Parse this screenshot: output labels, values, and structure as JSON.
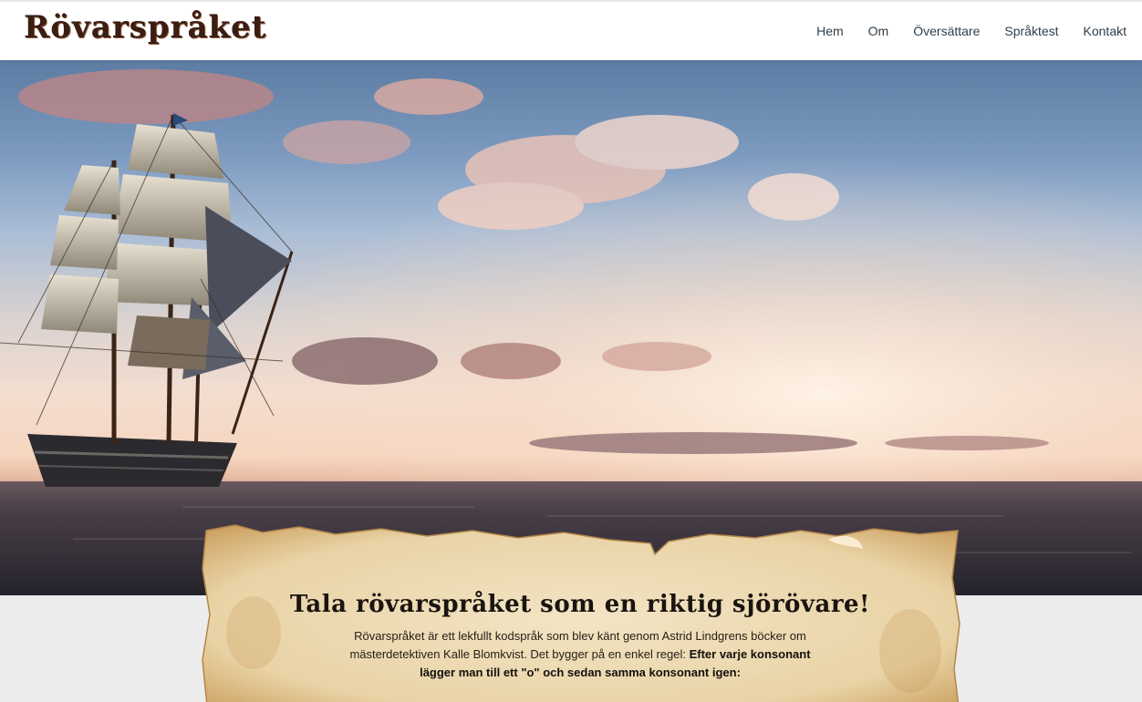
{
  "header": {
    "logo_text": "Rövarspråket",
    "nav": [
      {
        "label": "Hem"
      },
      {
        "label": "Om"
      },
      {
        "label": "Översättare"
      },
      {
        "label": "Språktest"
      },
      {
        "label": "Kontakt"
      }
    ]
  },
  "hero": {
    "image": "pirate-ship-at-sea"
  },
  "intro": {
    "title": "Tala rövarspråket som en riktig sjörövare!",
    "text_plain": "Rövarspråket är ett lekfullt kodspråk som blev känt genom Astrid Lindgrens böcker om mästerdetektiven Kalle Blomkvist. Det bygger på en enkel regel: ",
    "text_bold": "Efter varje konsonant lägger man till ett \"o\" och sedan samma konsonant igen:"
  },
  "colors": {
    "logo": "#3b1d12",
    "nav_text": "#2f3e4a",
    "page_bg": "#ececec",
    "parchment": "#e9d4a8"
  }
}
